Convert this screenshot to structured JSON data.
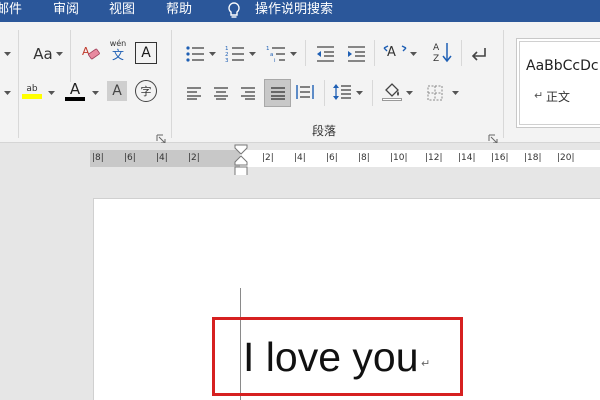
{
  "menu": {
    "items": [
      "邮件",
      "审阅",
      "视图",
      "帮助"
    ],
    "tell_me": "操作说明搜索"
  },
  "ribbon": {
    "font_group": {
      "change_case": "Aa",
      "phonetic_top": "wén",
      "phonetic_bottom": "文",
      "char_border": "A",
      "font_color": "A",
      "char_shading": "A",
      "enclose_char": "字",
      "highlight_label": "ab",
      "font_color_bar": "#000000",
      "highlight_color": "#ffff00"
    },
    "paragraph_group": {
      "label": "段落",
      "line_spacing_active": "justify"
    },
    "styles": {
      "sample": "AaBbCcDc",
      "name_mark": "↵",
      "name": "正文"
    }
  },
  "ruler": {
    "left_ticks": [
      "8",
      "6",
      "4",
      "2"
    ],
    "right_ticks": [
      "2",
      "4",
      "6",
      "8",
      "10",
      "12",
      "14",
      "16",
      "18",
      "20"
    ]
  },
  "document": {
    "text": "I love you",
    "para_mark": "↵"
  },
  "colors": {
    "title_bar": "#2b579a",
    "highlight_box": "#d62020"
  }
}
